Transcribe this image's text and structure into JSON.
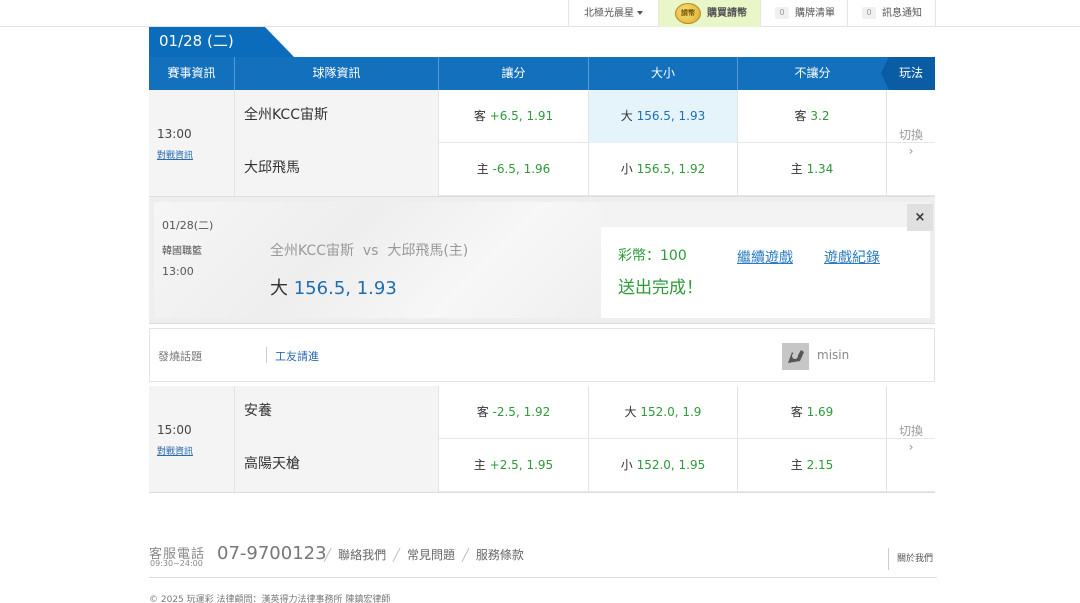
{
  "topbar": {
    "user": "北極光晨星",
    "buy_coins": "購買請幣",
    "coin_icon_text": "請幣",
    "cart_count": "0",
    "cart": "購牌清單",
    "msg_count": "0",
    "messages": "訊息通知"
  },
  "date_tab": "01/28 (二)",
  "table_header": {
    "info": "賽事資訊",
    "team": "球隊資訊",
    "handicap": "讓分",
    "over_under": "大小",
    "moneyline": "不讓分",
    "play": "玩法"
  },
  "matches": [
    {
      "time": "13:00",
      "link": "對戰資訊",
      "switch": "切換",
      "rows": [
        {
          "team": "全州KCC宙斯",
          "hdp_side": "客",
          "hdp_line": "+6.5,",
          "hdp_odds": "1.91",
          "ou_side": "大",
          "ou_value": "156.5, 1.93",
          "ml_side": "客",
          "ml_odds": "3.2"
        },
        {
          "team": "大邱飛馬",
          "hdp_side": "主",
          "hdp_line": "-6.5,",
          "hdp_odds": "1.96",
          "ou_side": "小",
          "ou_value": "156.5, 1.92",
          "ml_side": "主",
          "ml_odds": "1.34"
        }
      ]
    },
    {
      "time": "15:00",
      "link": "對戰資訊",
      "switch": "切換",
      "rows": [
        {
          "team": "安養",
          "hdp_side": "客",
          "hdp_line": "-2.5,",
          "hdp_odds": "1.92",
          "ou_side": "大",
          "ou_value": "152.0, 1.9",
          "ml_side": "客",
          "ml_odds": "1.69"
        },
        {
          "team": "高陽天槍",
          "hdp_side": "主",
          "hdp_line": "+2.5,",
          "hdp_odds": "1.95",
          "ou_side": "小",
          "ou_value": "152.0, 1.95",
          "ml_side": "主",
          "ml_odds": "2.15"
        }
      ]
    }
  ],
  "confirm": {
    "date": "01/28(二)",
    "league": "韓國職籃",
    "time": "13:00",
    "match": "全州KCC宙斯  vs  大邱飛馬(主)",
    "pick_side": "大",
    "pick_value": "156.5, 1.93",
    "coins": "彩幣：100",
    "done": "送出完成！",
    "continue": "繼續遊戲",
    "log": "遊戲紀錄",
    "close": "×"
  },
  "topic": {
    "label": "發燒話題",
    "title": "工友請進",
    "user": "misin"
  },
  "footer": {
    "service": "客服電話",
    "hours": "09:30~24:00",
    "phone": "07-9700123",
    "links": [
      "聯絡我們",
      "常見問題",
      "服務條款"
    ],
    "about": "關於我們",
    "copyright": "© 2025 玩運彩 法律顧問：漢英得力法律事務所 陳鎮宏律師"
  },
  "colors": {
    "header_blue": "#1370bd",
    "odds_green": "#2e9a3a",
    "link_blue": "#2a7bc2",
    "selected_bg": "#e5f4fb"
  }
}
